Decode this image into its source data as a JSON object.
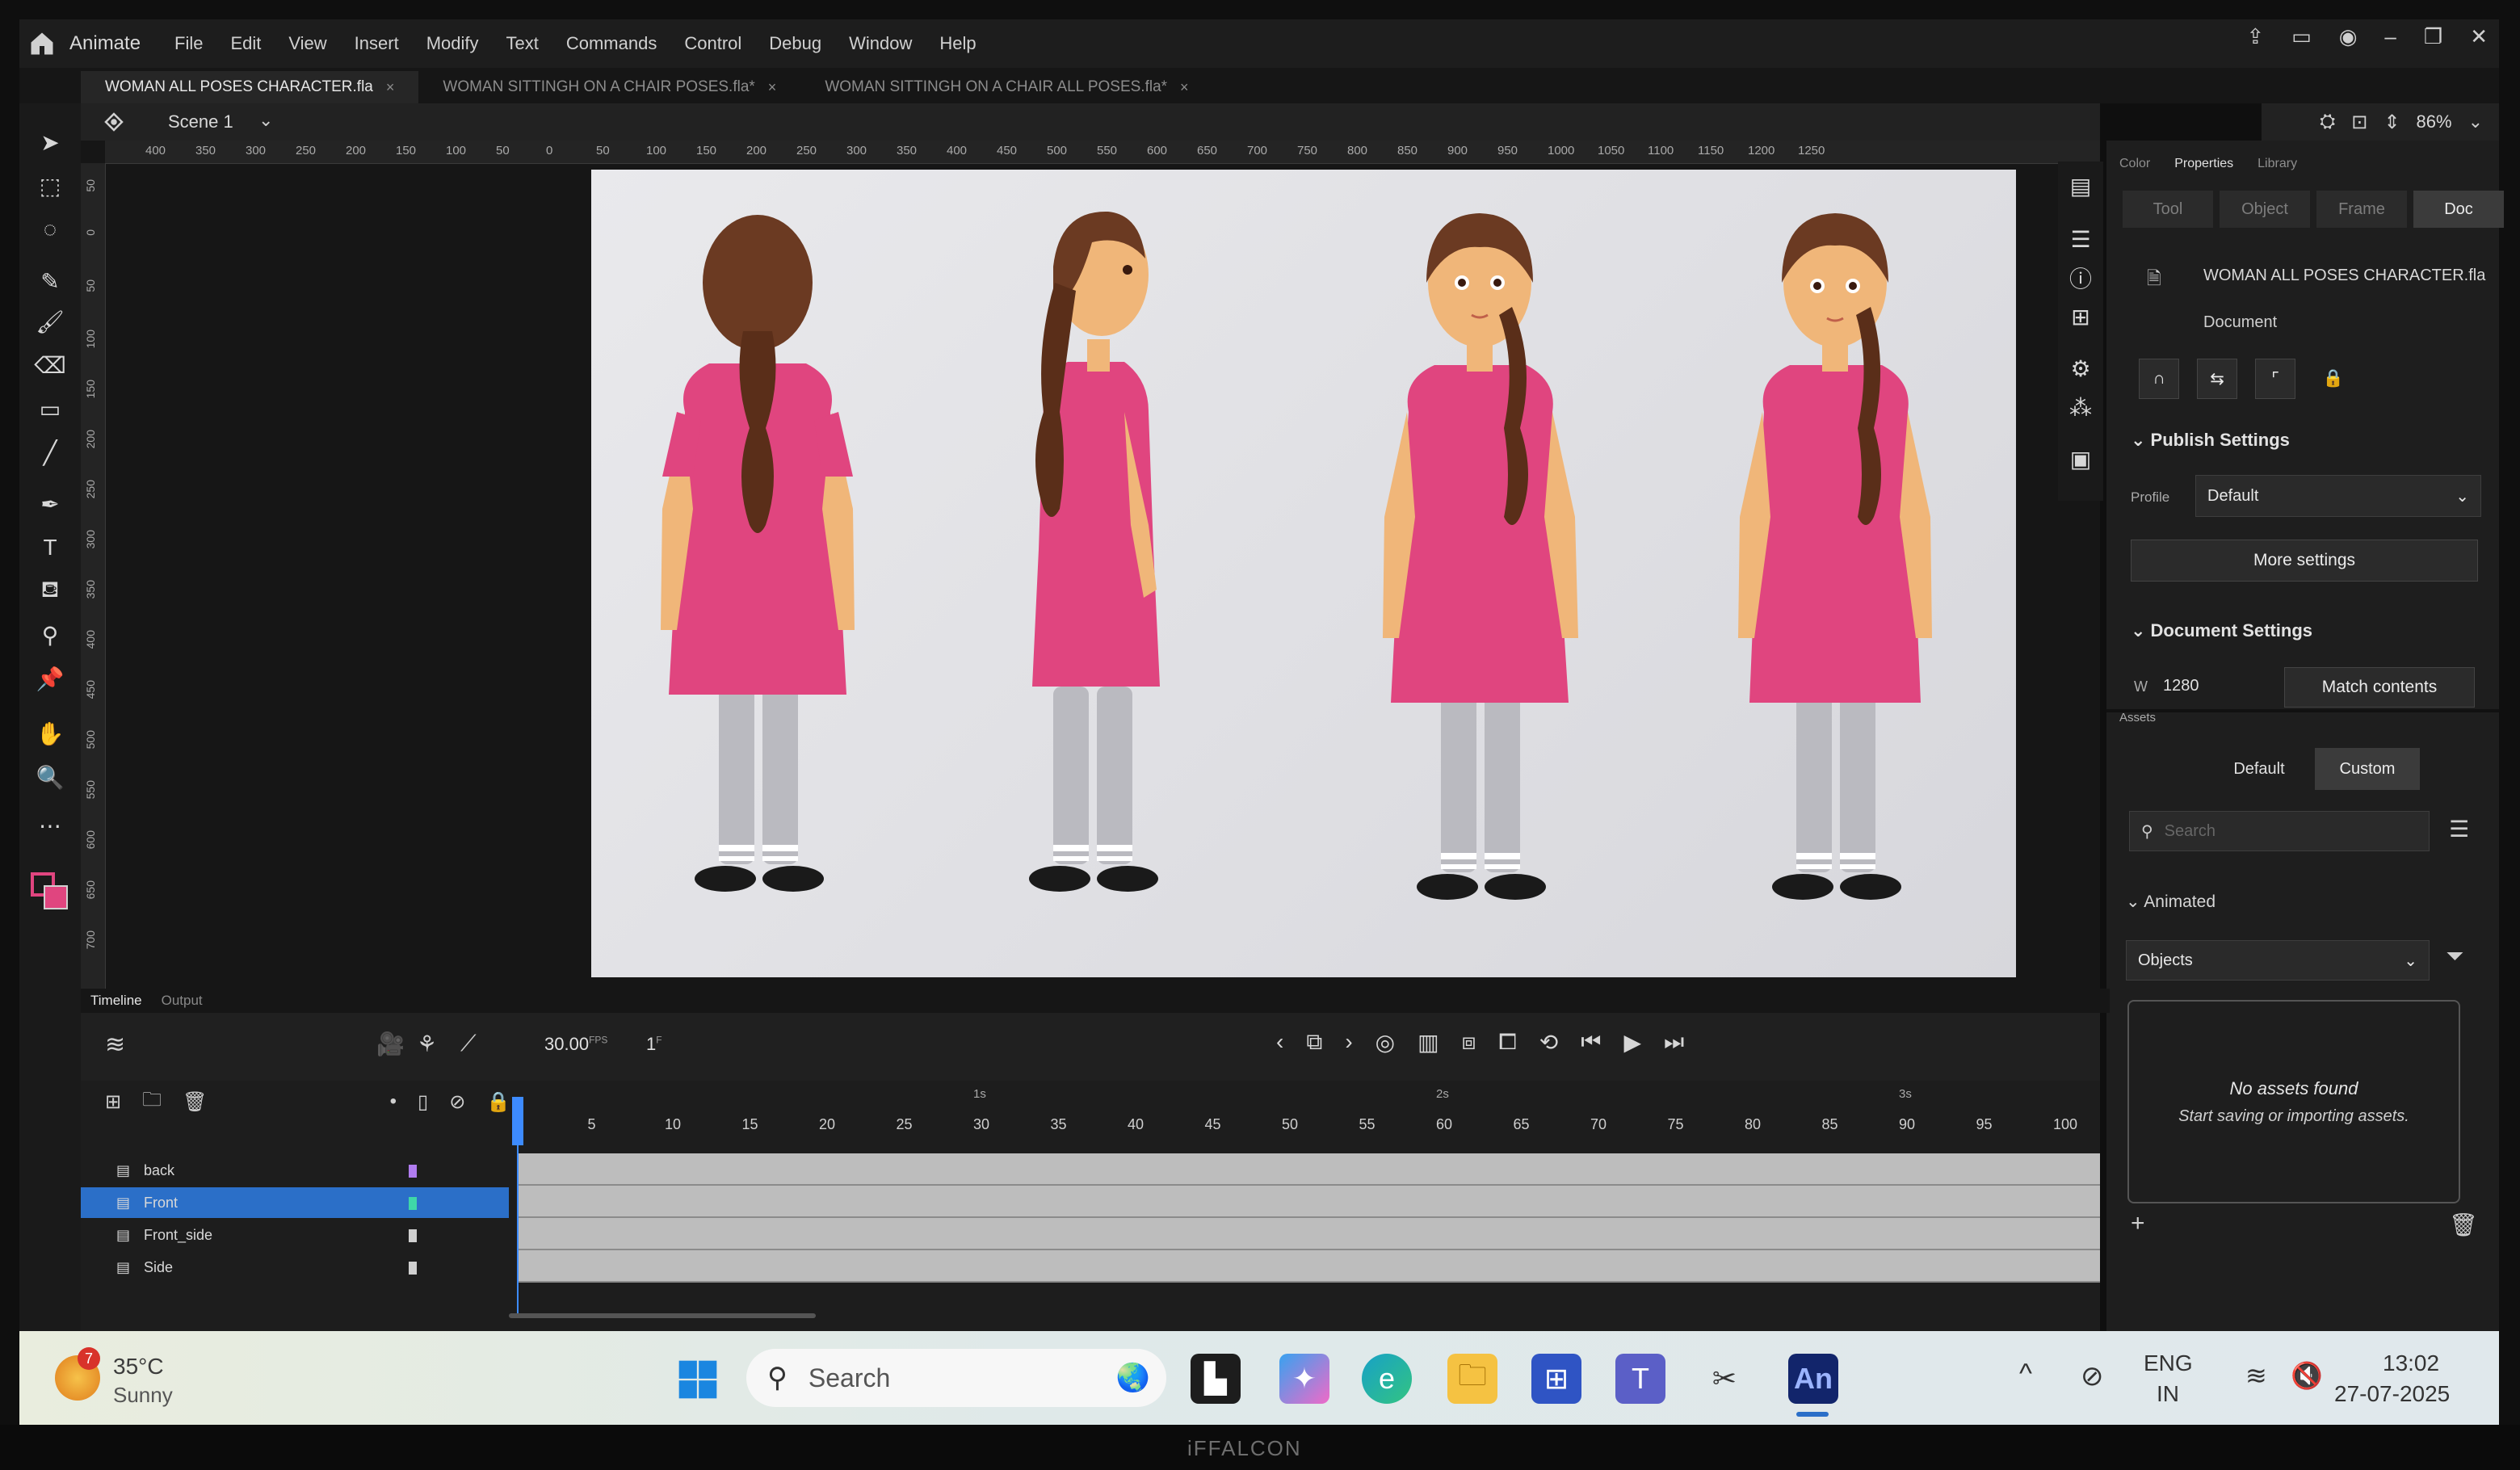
{
  "app": {
    "name": "Animate",
    "menu": [
      "File",
      "Edit",
      "View",
      "Insert",
      "Modify",
      "Text",
      "Commands",
      "Control",
      "Debug",
      "Window",
      "Help"
    ]
  },
  "tabs": [
    {
      "label": "WOMAN ALL POSES CHARACTER.fla",
      "active": true
    },
    {
      "label": "WOMAN SITTINGH ON A CHAIR POSES.fla*",
      "active": false
    },
    {
      "label": "WOMAN SITTINGH ON A CHAIR ALL POSES.fla*",
      "active": false
    }
  ],
  "tab_close": "×",
  "scene": {
    "name": "Scene 1"
  },
  "zoom": "86%",
  "ruler_h": [
    "400",
    "350",
    "300",
    "250",
    "200",
    "150",
    "100",
    "50",
    "0",
    "50",
    "100",
    "150",
    "200",
    "250",
    "300",
    "350",
    "400",
    "450",
    "500",
    "550",
    "600",
    "650",
    "700",
    "750",
    "800",
    "850",
    "900",
    "950",
    "1000",
    "1050",
    "1100",
    "1150",
    "1200",
    "1250"
  ],
  "ruler_v": [
    "50",
    "0",
    "50",
    "100",
    "150",
    "200",
    "250",
    "300",
    "350",
    "400",
    "450",
    "500",
    "550",
    "600",
    "650",
    "700"
  ],
  "right_panel": {
    "top_tabs": [
      "Color",
      "Properties",
      "Library"
    ],
    "sub_tabs": [
      "Tool",
      "Object",
      "Frame",
      "Doc"
    ],
    "active_sub_tab": "Doc",
    "doc_name": "WOMAN ALL POSES CHARACTER.fla",
    "doc_label": "Document",
    "publish_settings": "Publish Settings",
    "profile_label": "Profile",
    "profile_value": "Default",
    "more_settings": "More settings",
    "document_settings": "Document Settings",
    "w_label": "W",
    "w_value": "1280",
    "match_contents": "Match contents",
    "assets_title": "Assets",
    "assets_tabs": [
      "Default",
      "Custom"
    ],
    "search_placeholder": "Search",
    "animated_label": "Animated",
    "objects_dropdown": "Objects",
    "no_assets": "No assets found",
    "no_assets_hint": "Start saving or importing assets."
  },
  "timeline": {
    "tabs": [
      "Timeline",
      "Output"
    ],
    "fps": "30.00",
    "fps_unit": "FPS",
    "frame": "1",
    "frame_unit": "F",
    "seconds_marks": [
      "1s",
      "2s",
      "3s"
    ],
    "frame_numbers": [
      "5",
      "10",
      "15",
      "20",
      "25",
      "30",
      "35",
      "40",
      "45",
      "50",
      "55",
      "60",
      "65",
      "70",
      "75",
      "80",
      "85",
      "90",
      "95",
      "100"
    ],
    "layers": [
      {
        "name": "back",
        "color": "#b07cf0",
        "selected": false
      },
      {
        "name": "Front",
        "color": "#3fd7a8",
        "selected": true
      },
      {
        "name": "Front_side",
        "color": "#d0d0d0",
        "selected": false
      },
      {
        "name": "Side",
        "color": "#d0d0d0",
        "selected": false
      }
    ]
  },
  "taskbar": {
    "weather_temp": "35°C",
    "weather_desc": "Sunny",
    "weather_badge": "7",
    "search_placeholder": "Search",
    "language": "ENG",
    "region": "IN",
    "time": "13:02",
    "date": "27-07-2025",
    "animate_label": "An"
  },
  "bezel_brand": "iFFALCON",
  "colors": {
    "accent": "#2b6fc8",
    "dress": "#e0457f",
    "hair": "#6b3a22",
    "skin": "#f0b679",
    "pants": "#b9b9bd"
  }
}
